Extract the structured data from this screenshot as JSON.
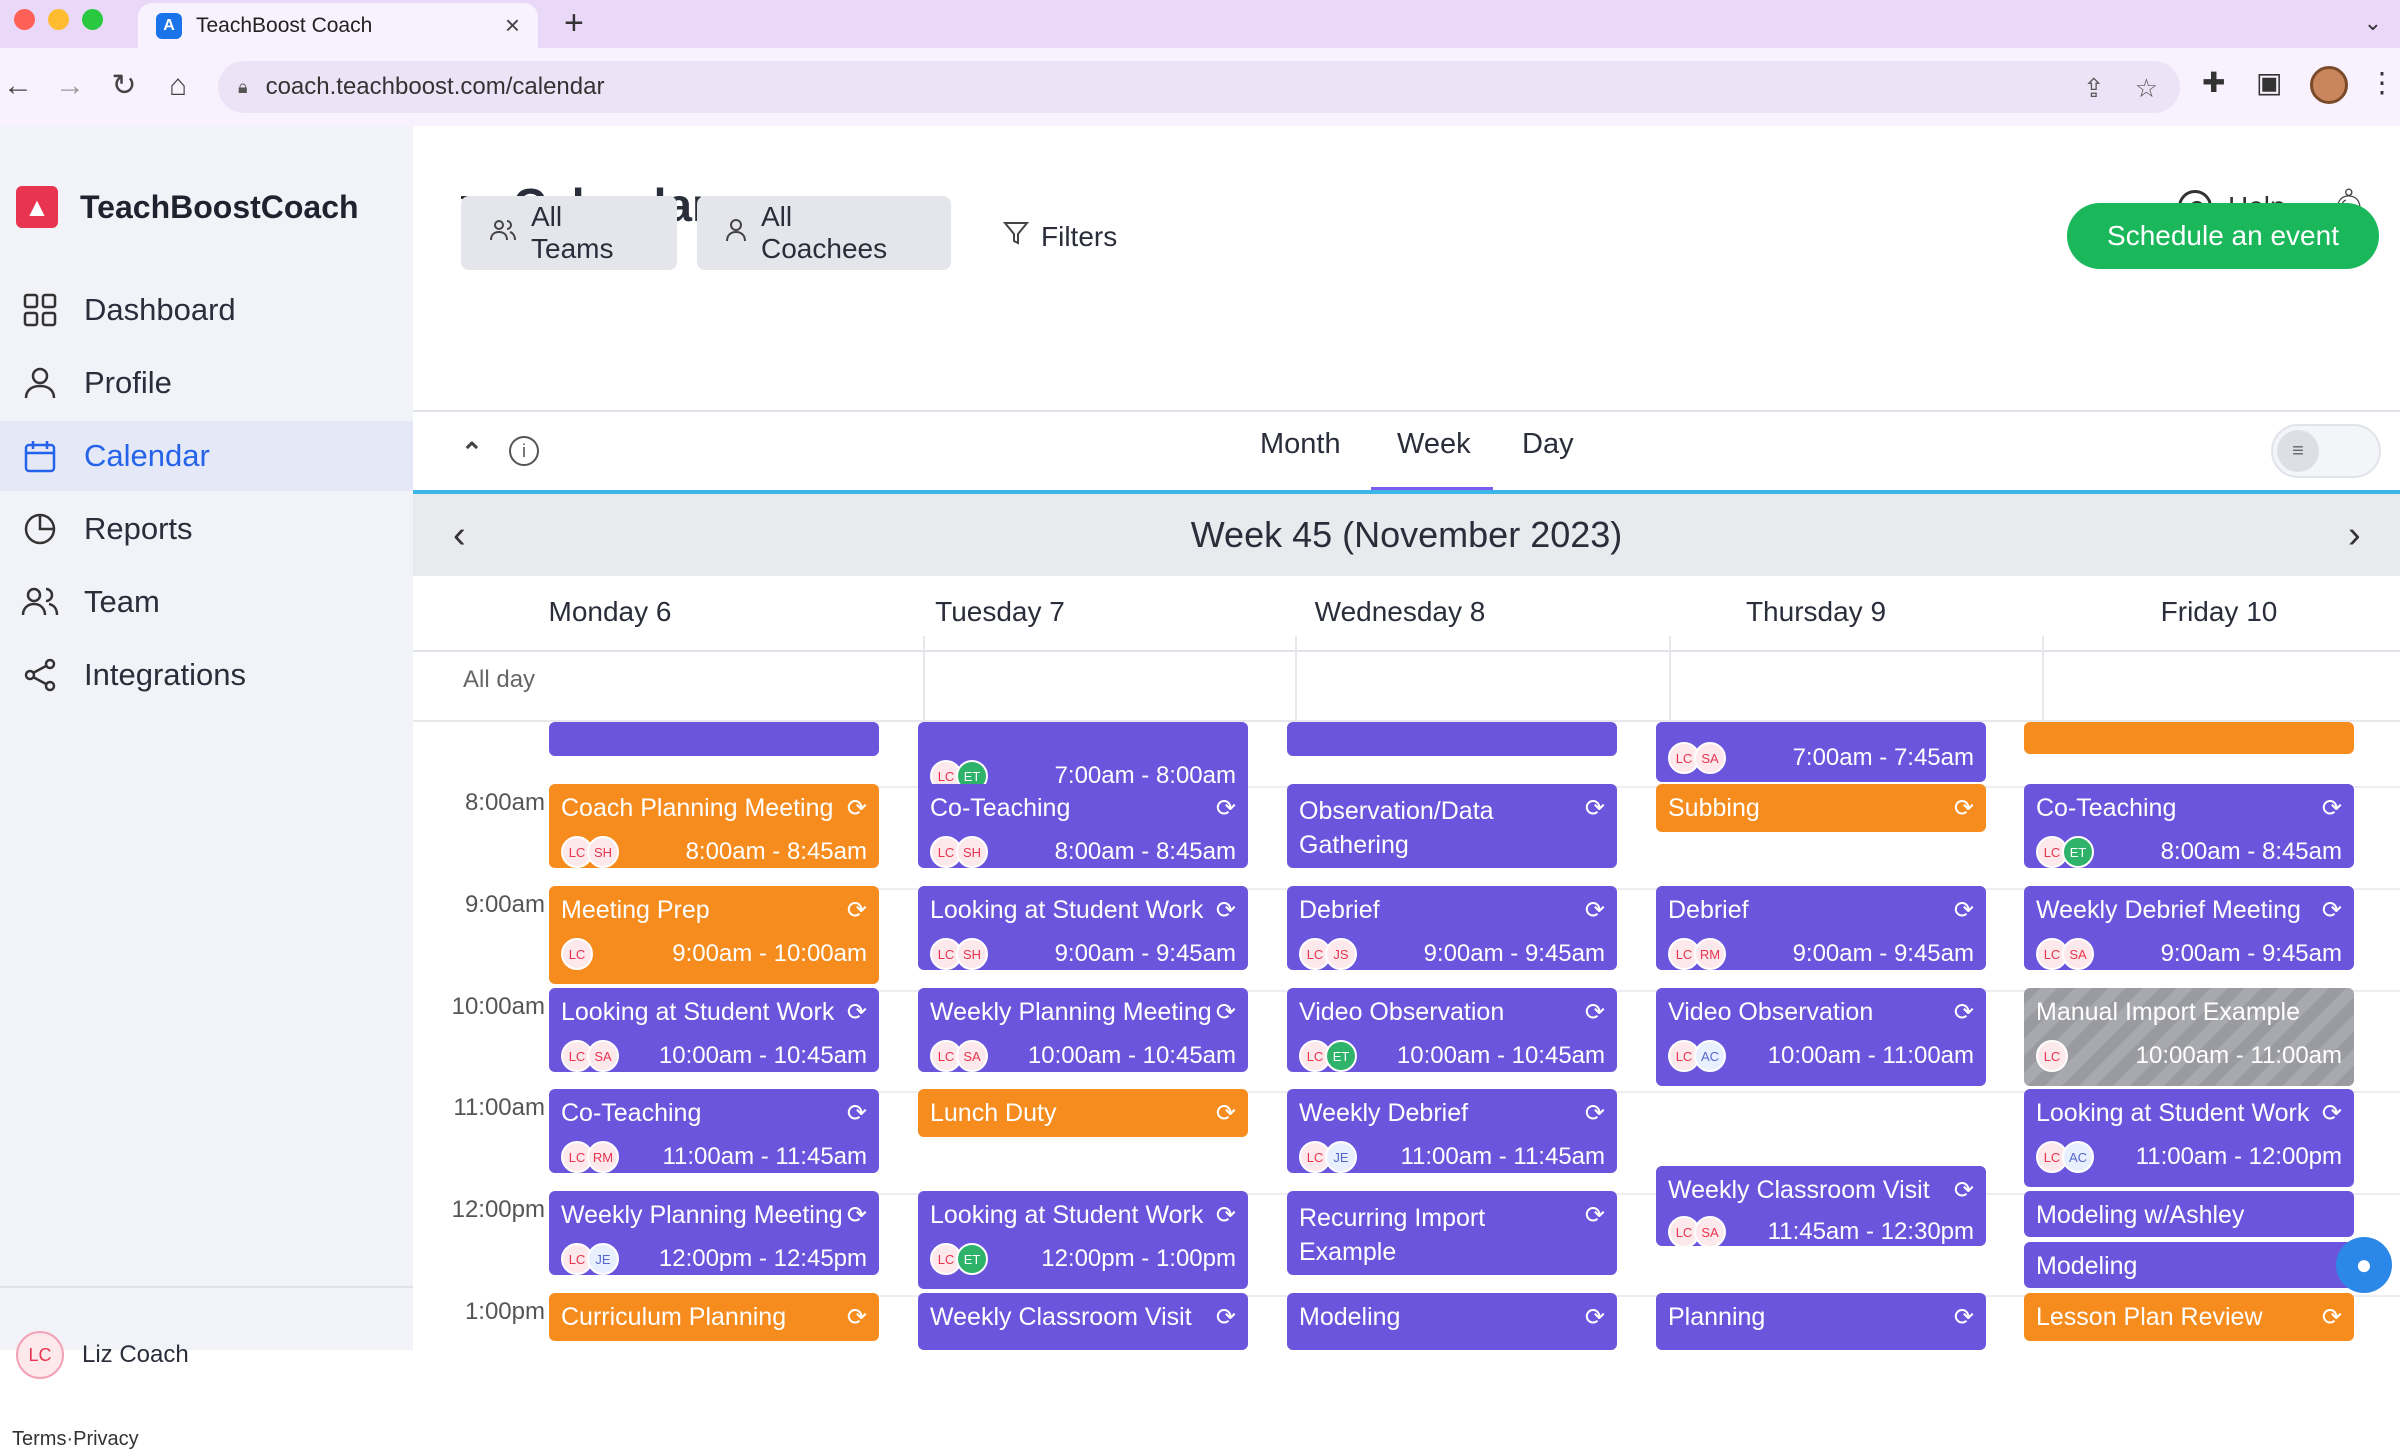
{
  "browser": {
    "tab_title": "TeachBoost Coach",
    "tab_favicon": "A",
    "new_tab": "+",
    "url": "coach.teachboost.com/calendar"
  },
  "sidebar": {
    "logo_mark": "▲",
    "brand": "TeachBoostCoach",
    "items": [
      {
        "label": "Dashboard",
        "icon": "dashboard-grid-icon"
      },
      {
        "label": "Profile",
        "icon": "person-icon"
      },
      {
        "label": "Calendar",
        "icon": "calendar-icon",
        "active": true
      },
      {
        "label": "Reports",
        "icon": "pie-chart-icon"
      },
      {
        "label": "Team",
        "icon": "people-icon"
      },
      {
        "label": "Integrations",
        "icon": "share-icon"
      }
    ],
    "user_initials": "LC",
    "user_name": "Liz Coach",
    "footer": "Terms·Privacy"
  },
  "header": {
    "title": "Calendar",
    "help": "Help",
    "filter_teams": "All Teams",
    "filter_coachees": "All Coachees",
    "filters": "Filters",
    "schedule": "Schedule an event"
  },
  "views": {
    "month": "Month",
    "week": "Week",
    "day": "Day",
    "active": "Week"
  },
  "week_title": "Week 45 (November 2023)",
  "days": [
    "Monday 6",
    "Tuesday 7",
    "Wednesday 8",
    "Thursday 9",
    "Friday 10"
  ],
  "all_day": "All day",
  "times": [
    "8:00am",
    "9:00am",
    "10:00am",
    "11:00am",
    "12:00pm",
    "1:00pm"
  ],
  "events": {
    "mon_prev": {},
    "mon_coach": {
      "title": "Coach Planning Meeting",
      "time": "8:00am - 8:45am",
      "a": "LC",
      "b": "SH"
    },
    "mon_prep": {
      "title": "Meeting Prep",
      "time": "9:00am - 10:00am",
      "a": "LC"
    },
    "mon_lsw": {
      "title": "Looking at Student Work",
      "time": "10:00am - 10:45am",
      "a": "LC",
      "b": "SA"
    },
    "mon_cot": {
      "title": "Co-Teaching",
      "time": "11:00am - 11:45am",
      "a": "LC",
      "b": "RM"
    },
    "mon_wpm": {
      "title": "Weekly Planning Meeting",
      "time": "12:00pm - 12:45pm",
      "a": "LC",
      "b": "JE"
    },
    "mon_cur": {
      "title": "Curriculum Planning"
    },
    "tue_prev": {
      "time": "7:00am - 8:00am",
      "a": "LC",
      "b": "ET"
    },
    "tue_cot": {
      "title": "Co-Teaching",
      "time": "8:00am - 8:45am",
      "a": "LC",
      "b": "SH"
    },
    "tue_lsw": {
      "title": "Looking at Student Work",
      "time": "9:00am - 9:45am",
      "a": "LC",
      "b": "SH"
    },
    "tue_wpm": {
      "title": "Weekly Planning Meeting",
      "time": "10:00am - 10:45am",
      "a": "LC",
      "b": "SA"
    },
    "tue_lunch": {
      "title": "Lunch Duty"
    },
    "tue_lsw2": {
      "title": "Looking at Student Work",
      "time": "12:00pm - 1:00pm",
      "a": "LC",
      "b": "ET"
    },
    "tue_wcv": {
      "title": "Weekly Classroom Visit"
    },
    "wed_prev": {},
    "wed_obs": {
      "title": "Observation/Data Gathering"
    },
    "wed_deb": {
      "title": "Debrief",
      "time": "9:00am - 9:45am",
      "a": "LC",
      "b": "JS"
    },
    "wed_vid": {
      "title": "Video Observation",
      "time": "10:00am - 10:45am",
      "a": "LC",
      "b": "ET"
    },
    "wed_wd": {
      "title": "Weekly Debrief",
      "time": "11:00am - 11:45am",
      "a": "LC",
      "b": "JE"
    },
    "wed_rie": {
      "title": "Recurring Import Example"
    },
    "wed_mod": {
      "title": "Modeling"
    },
    "thu_prev": {
      "time": "7:00am - 7:45am",
      "a": "LC",
      "b": "SA"
    },
    "thu_sub": {
      "title": "Subbing"
    },
    "thu_deb": {
      "title": "Debrief",
      "time": "9:00am - 9:45am",
      "a": "LC",
      "b": "RM"
    },
    "thu_vid": {
      "title": "Video Observation",
      "time": "10:00am - 11:00am",
      "a": "LC",
      "b": "AC"
    },
    "thu_wcv": {
      "title": "Weekly Classroom Visit",
      "time": "11:45am - 12:30pm",
      "a": "LC",
      "b": "SA"
    },
    "thu_plan": {
      "title": "Planning"
    },
    "fri_prev": {},
    "fri_cot": {
      "title": "Co-Teaching",
      "time": "8:00am - 8:45am",
      "a": "LC",
      "b": "ET"
    },
    "fri_wdm": {
      "title": "Weekly Debrief Meeting",
      "time": "9:00am - 9:45am",
      "a": "LC",
      "b": "SA"
    },
    "fri_mie": {
      "title": "Manual Import Example",
      "time": "10:00am - 11:00am",
      "a": "LC"
    },
    "fri_lsw": {
      "title": "Looking at Student Work",
      "time": "11:00am - 12:00pm",
      "a": "LC",
      "b": "AC"
    },
    "fri_mwa": {
      "title": "Modeling w/Ashley"
    },
    "fri_mod": {
      "title": "Modeling"
    },
    "fri_lpr": {
      "title": "Lesson Plan Review"
    }
  },
  "colors": {
    "purple": "#6b55dc",
    "orange": "#f78c1e",
    "green": "#1ab85b",
    "accent": "#2563eb"
  }
}
